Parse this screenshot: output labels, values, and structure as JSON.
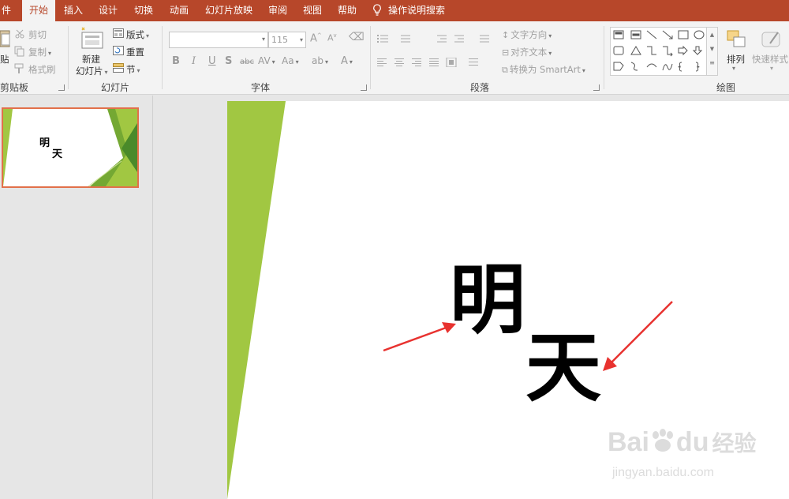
{
  "menu": {
    "tabs": [
      "件",
      "开始",
      "插入",
      "设计",
      "切换",
      "动画",
      "幻灯片放映",
      "审阅",
      "视图",
      "帮助"
    ],
    "tell_me": "操作说明搜索"
  },
  "ribbon": {
    "clipboard": {
      "paste": "贴",
      "cut": "剪切",
      "copy": "复制",
      "format_painter": "格式刷",
      "label": "剪贴板"
    },
    "slides": {
      "new_slide_line1": "新建",
      "new_slide_line2": "幻灯片",
      "layout": "版式",
      "reset": "重置",
      "section": "节",
      "label": "幻灯片"
    },
    "font": {
      "font_name": "",
      "font_size": "115",
      "label": "字体"
    },
    "paragraph": {
      "text_direction": "文字方向",
      "align_text": "对齐文本",
      "smartart": "转换为 SmartArt",
      "label": "段落"
    },
    "drawing": {
      "arrange": "排列",
      "quick_styles": "快速样式",
      "label": "绘图"
    }
  },
  "thumbnail": {
    "char1": "明",
    "char2": "天"
  },
  "slide": {
    "char1": "明",
    "char2": "天"
  },
  "watermark": {
    "brand": "Bai",
    "brand2": "du",
    "brand_cn": "经验",
    "url": "jingyan.baidu.com"
  },
  "colors": {
    "accent": "#b7472a",
    "green": "#a1c742",
    "arrow": "#e8322f"
  }
}
